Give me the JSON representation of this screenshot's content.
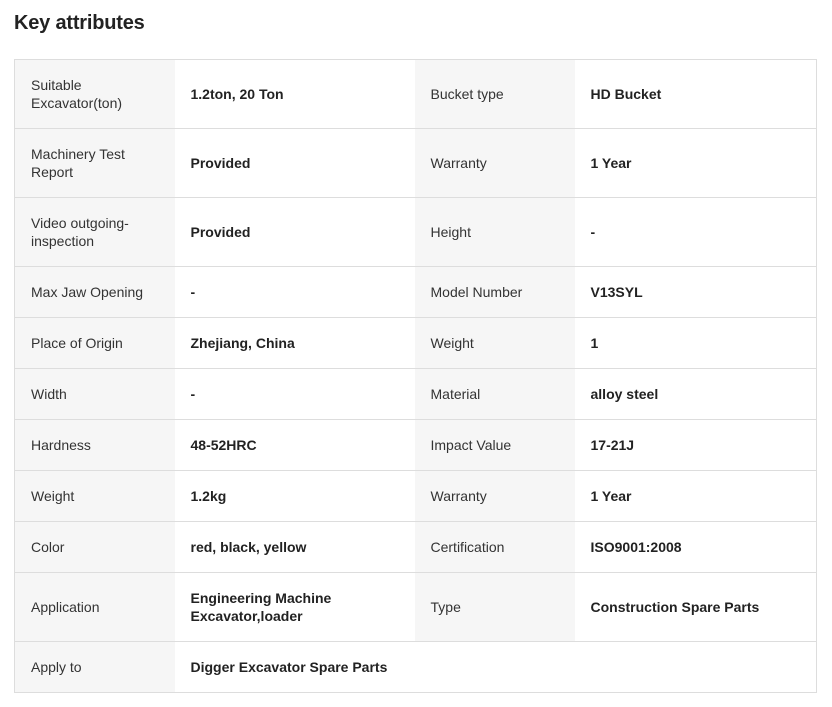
{
  "title": "Key attributes",
  "rows": [
    {
      "l1": "Suitable Excavator(ton)",
      "v1": "1.2ton, 20 Ton",
      "l2": "Bucket type",
      "v2": "HD Bucket"
    },
    {
      "l1": "Machinery Test Report",
      "v1": "Provided",
      "l2": "Warranty",
      "v2": "1 Year"
    },
    {
      "l1": "Video outgoing-inspection",
      "v1": "Provided",
      "l2": "Height",
      "v2": "-"
    },
    {
      "l1": "Max Jaw Opening",
      "v1": "-",
      "l2": "Model Number",
      "v2": "V13SYL"
    },
    {
      "l1": "Place of Origin",
      "v1": "Zhejiang, China",
      "l2": "Weight",
      "v2": "1"
    },
    {
      "l1": "Width",
      "v1": "-",
      "l2": "Material",
      "v2": "alloy steel"
    },
    {
      "l1": "Hardness",
      "v1": "48-52HRC",
      "l2": "Impact Value",
      "v2": "17-21J"
    },
    {
      "l1": "Weight",
      "v1": "1.2kg",
      "l2": "Warranty",
      "v2": "1 Year"
    },
    {
      "l1": "Color",
      "v1": "red, black, yellow",
      "l2": "Certification",
      "v2": "ISO9001:2008"
    },
    {
      "l1": "Application",
      "v1": "Engineering Machine Excavator,loader",
      "l2": "Type",
      "v2": "Construction Spare Parts"
    },
    {
      "l1": "Apply to",
      "v1": "Digger Excavator Spare Parts"
    }
  ]
}
